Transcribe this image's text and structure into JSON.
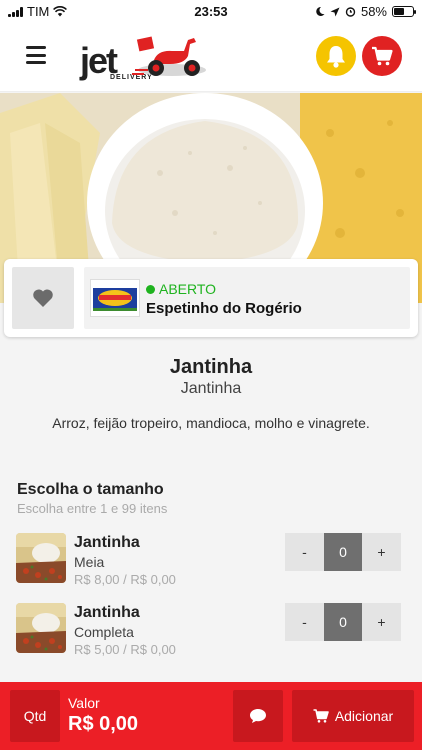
{
  "status_bar": {
    "carrier": "TIM",
    "time": "23:53",
    "battery": "58%"
  },
  "header": {
    "logo_main": "jet",
    "logo_sub": "DELIVERY"
  },
  "store": {
    "status": "ABERTO",
    "name": "Espetinho do Rogério",
    "status_color": "#1fb31f"
  },
  "product": {
    "title": "Jantinha",
    "subtitle": "Jantinha",
    "description": "Arroz, feijão tropeiro, mandioca, molho e vinagrete."
  },
  "options_section": {
    "title": "Escolha o tamanho",
    "subtitle": "Escolha entre 1 e 99 itens",
    "items": [
      {
        "name": "Jantinha",
        "size": "Meia",
        "price": "R$ 8,00 / R$ 0,00",
        "quantity": "0",
        "minus": "-",
        "plus": "+"
      },
      {
        "name": "Jantinha",
        "size": "Completa",
        "price": "R$ 5,00 / R$ 0,00",
        "quantity": "0",
        "minus": "-",
        "plus": "+"
      }
    ]
  },
  "bottom_bar": {
    "qtd_label": "Qtd",
    "valor_label": "Valor",
    "valor": "R$ 0,00",
    "add_label": "Adicionar"
  },
  "colors": {
    "accent": "#ec1f26",
    "bell": "#f5c400",
    "cart": "#e02222"
  },
  "icons": [
    "hamburger-icon",
    "bell-icon",
    "cart-icon",
    "heart-icon",
    "chat-icon",
    "cart-small-icon"
  ]
}
